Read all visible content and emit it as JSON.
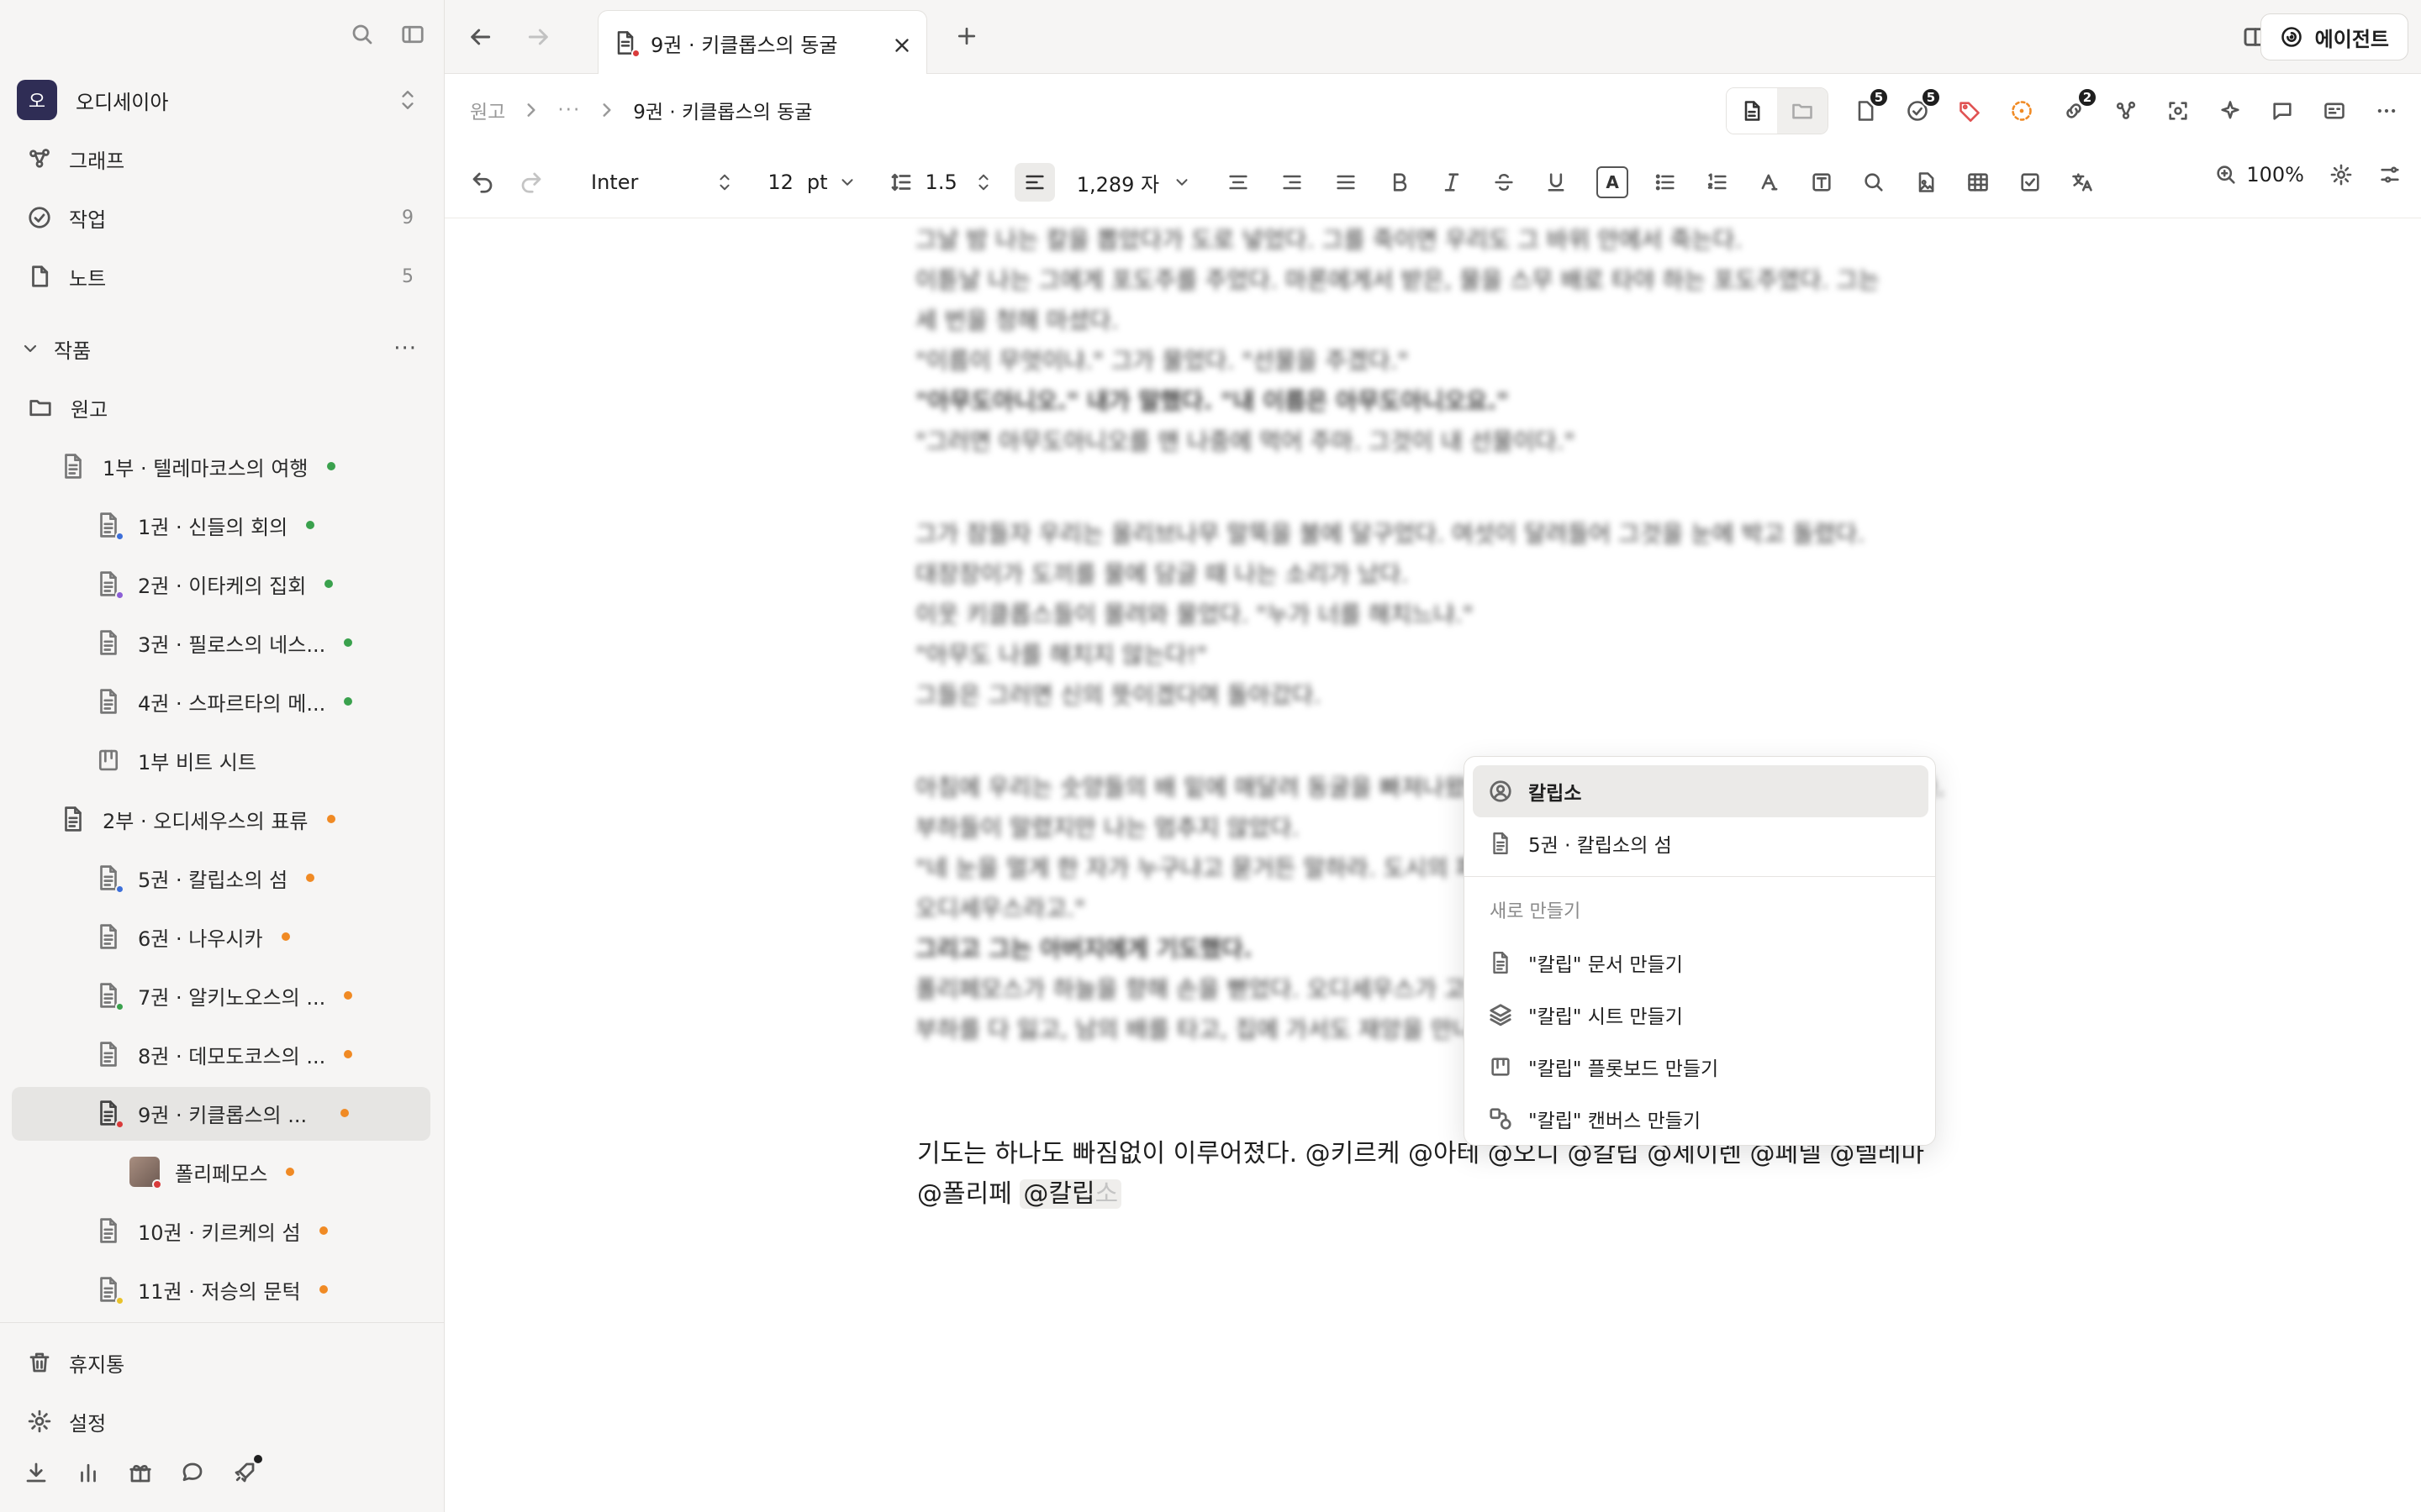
{
  "sidebar": {
    "workspace": {
      "avatar_letter": "오",
      "name": "오디세이아"
    },
    "nav": [
      {
        "label": "그래프",
        "icon": "graph-icon",
        "count": ""
      },
      {
        "label": "작업",
        "icon": "task-check-icon",
        "count": "9"
      },
      {
        "label": "노트",
        "icon": "note-icon",
        "count": "5"
      }
    ],
    "section_title": "작품",
    "root_folder": "원고",
    "tree": [
      {
        "label": "1부 · 텔레마코스의 여행",
        "dot": "green"
      },
      {
        "label": "1권 · 신들의 회의",
        "dot": "green",
        "mini": "#3d6fd9"
      },
      {
        "label": "2권 · 이타케의 집회",
        "dot": "green",
        "mini": "#8c5fd6"
      },
      {
        "label": "3권 · 필로스의 네스...",
        "dot": "green"
      },
      {
        "label": "4권 · 스파르타의 메...",
        "dot": "green"
      },
      {
        "label": "1부 비트 시트",
        "dot": ""
      },
      {
        "label": "2부 · 오디세우스의 표류",
        "dot": "orange"
      },
      {
        "label": "5권 · 칼립소의 섬",
        "dot": "orange",
        "mini": "#3d6fd9"
      },
      {
        "label": "6권 · 나우시카",
        "dot": "orange"
      },
      {
        "label": "7권 · 알키노오스의 ...",
        "dot": "orange",
        "mini": "#3aa14d"
      },
      {
        "label": "8권 · 데모도코스의 ...",
        "dot": "orange"
      },
      {
        "label": "9권 · 키클롭스의 ...",
        "dot": "orange",
        "mini": "#d93b3b"
      },
      {
        "label": "폴리페모스",
        "dot": "orange"
      },
      {
        "label": "10권 · 키르케의 섬",
        "dot": "orange"
      },
      {
        "label": "11권 · 저승의 문턱",
        "dot": "orange",
        "mini": "#e8c22a"
      }
    ],
    "trash": "휴지통",
    "settings": "설정"
  },
  "tab": {
    "title": "9권 · 키클롭스의 동굴"
  },
  "agent_button": "에이전트",
  "breadcrumb": {
    "root": "원고",
    "ellipsis": "···",
    "current": "9권 · 키클롭스의 동굴"
  },
  "badges": {
    "docs": "5",
    "tasks": "5",
    "links": "2"
  },
  "toolbar": {
    "font": "Inter",
    "size": "12",
    "unit": "pt",
    "line_height": "1.5",
    "char_count": "1,289 자",
    "zoom": "100%"
  },
  "editor": {
    "blurred_lines": [
      "그날 밤 나는 칼을 뽑았다가 도로 넣었다. 그를 죽이면 우리도 그 바위 안에서 죽는다.",
      "이튿날 나는 그에게 포도주를 주었다. 마론에게서 받은, 물을 스무 배로 타야 하는 포도주였다. 그는",
      "세 번을 청해 마셨다.",
      "\"이름이 무엇이냐.\" 그가 물었다. \"선물을 주겠다.\"",
      "\"아무도아니오.\" 내가 말했다. \"내 이름은 아무도아니오요.\"",
      "\"그러면 아무도아니오를 맨 나중에 먹어 주마. 그것이 내 선물이다.\"",
      "",
      "그가 잠들자 우리는 올리브나무 말뚝을 불에 달구었다. 여섯이 달려들어 그것을 눈에 박고 돌렸다.",
      "대장장이가 도끼를 물에 담글 때 나는 소리가 났다.",
      "이웃 키클롭스들이 몰려와 물었다. \"누가 너를 해치느냐.\"",
      "\"아무도 나를 해치지 않는다!\"",
      "그들은 그러면 신의 뜻이겠다며 돌아갔다.",
      "",
      "아침에 우리는 숫양들의 배 밑에 매달려 동굴을 빠져나왔다. 배에 오르고 나서 나는 참지 못하고 소리쳤다.",
      "부하들이 말렸지만 나는 멈추지 않았다.",
      "\"네 눈을 멀게 한 자가 누구냐고 묻거든 말하라. 도시의 파괴자, 이타케에 사는 라에르테스의 아들",
      "오디세우스라고.\"",
      "그리고 그는 아버지에게 기도했다.",
      "폴리페모스가 하늘을 향해 손을 뻗었다. 오디세우스가 고향에 닿지 못하게 해 달라고. 닿더라도 늦게,",
      "부하를 다 잃고, 남의 배를 타고, 집에 가서도 재앙을 만나게 해 달라고."
    ],
    "line1": "기도는 하나도 빠짐없이 이루어졌다. @키르케 @아테 @오디 @칼립 @세이렌 @페넬 @텔레마",
    "line2_prefix": "@폴리페 ",
    "mention_typed": "@칼립",
    "mention_ghost": "소"
  },
  "popup": {
    "items": [
      {
        "label": "칼립소",
        "icon": "person-icon"
      },
      {
        "label": "5권 · 칼립소의 섬",
        "icon": "document-icon"
      }
    ],
    "section": "새로 만들기",
    "create": [
      {
        "label": "\"칼립\" 문서 만들기",
        "icon": "document-icon"
      },
      {
        "label": "\"칼립\" 시트 만들기",
        "icon": "layers-icon"
      },
      {
        "label": "\"칼립\" 플롯보드 만들기",
        "icon": "board-icon"
      },
      {
        "label": "\"칼립\" 캔버스 만들기",
        "icon": "canvas-icon"
      }
    ]
  }
}
